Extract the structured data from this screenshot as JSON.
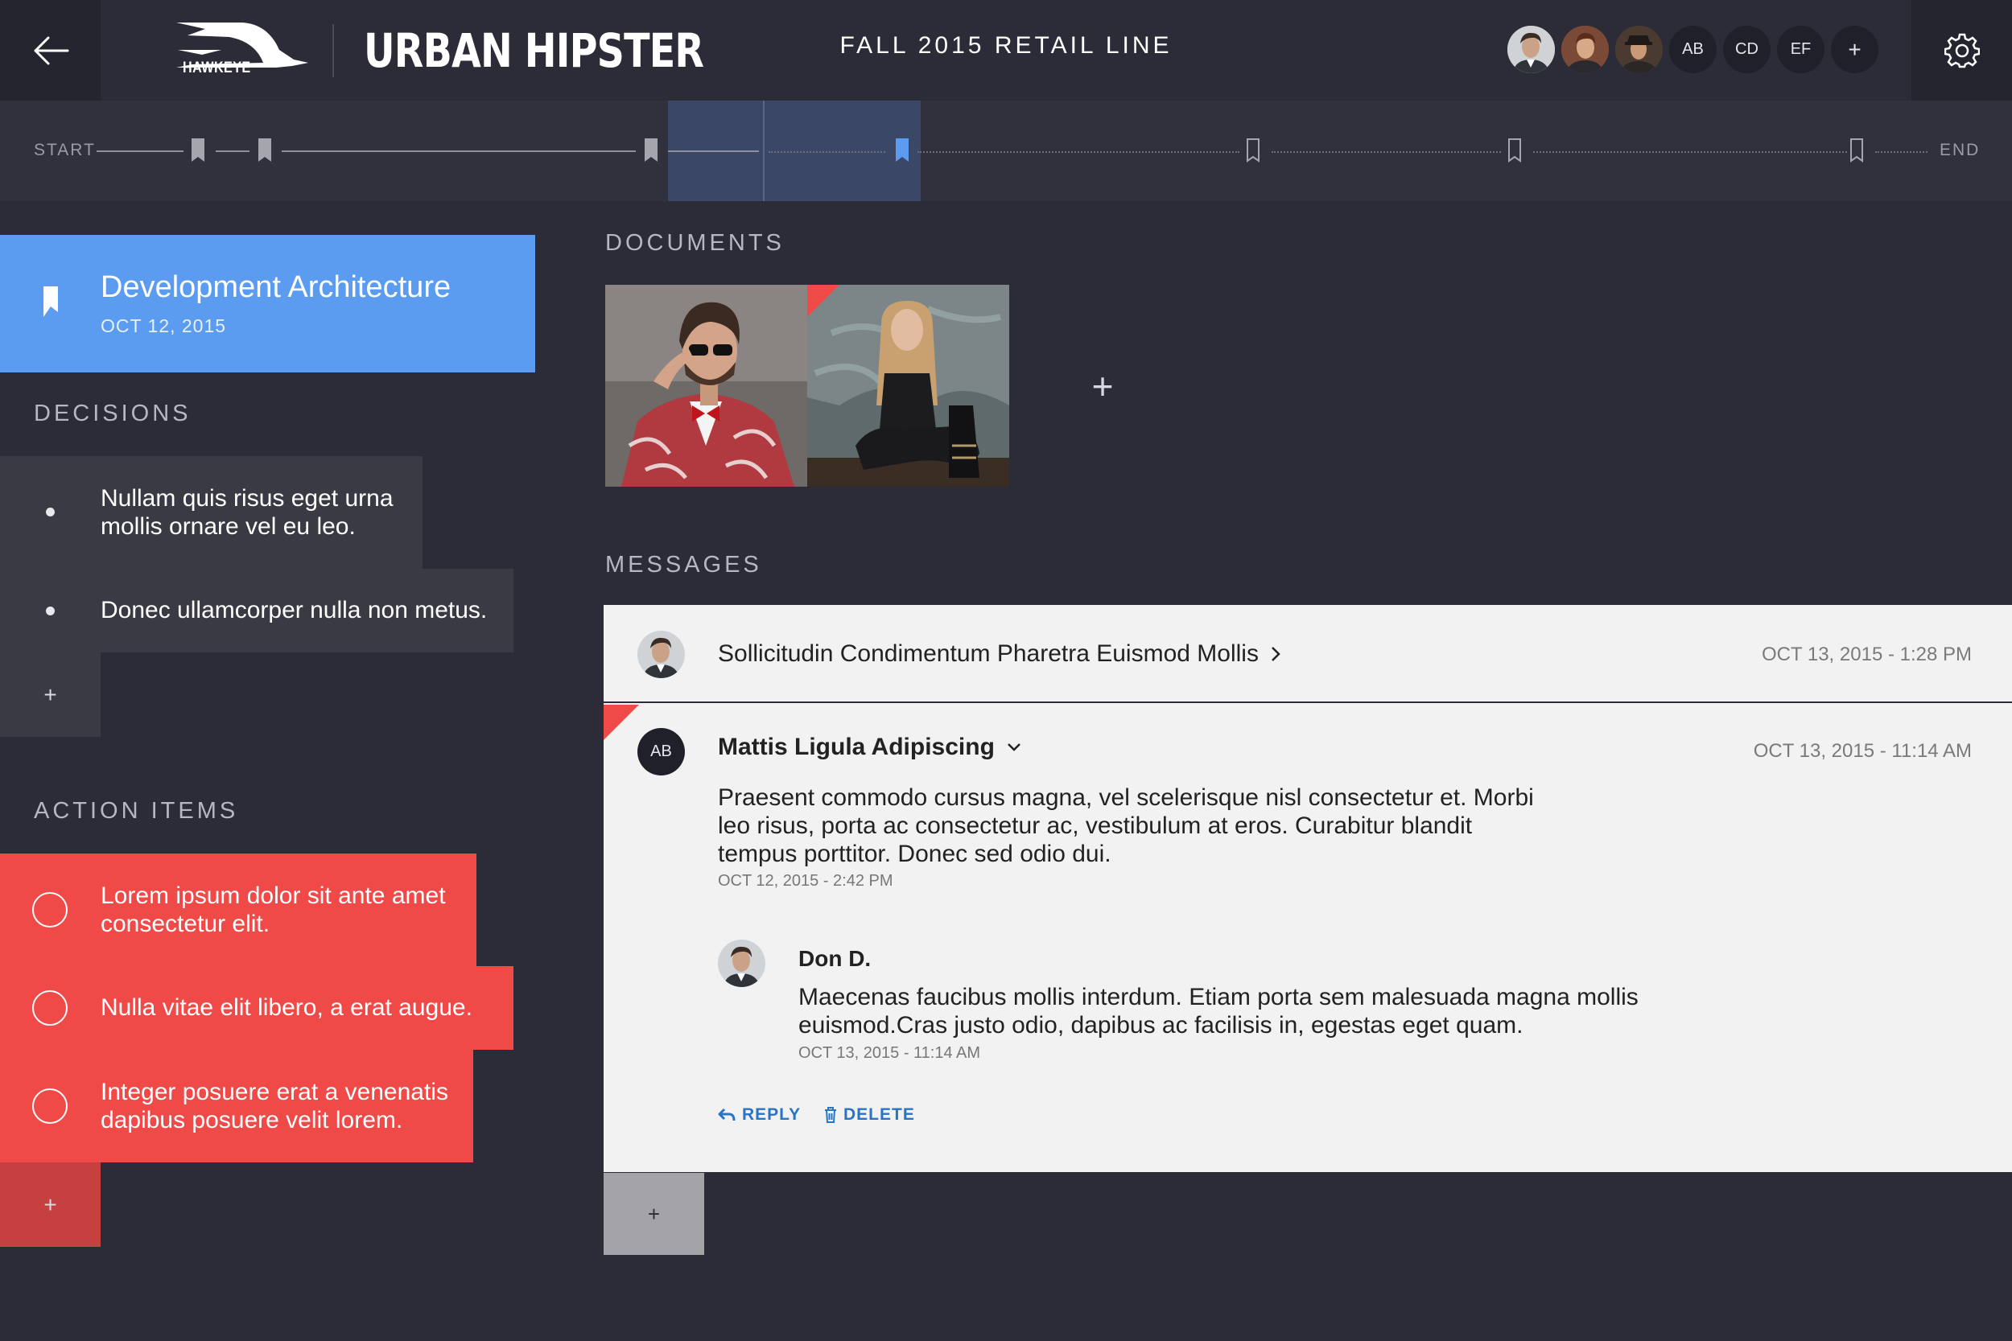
{
  "header": {
    "logo_text": "HAWKEYE",
    "brand": "URBAN HIPSTER",
    "project_title": "FALL 2015 RETAIL LINE",
    "collaborators": [
      "AB",
      "CD",
      "EF"
    ],
    "add_collaborator": "+"
  },
  "timeline": {
    "start_label": "START",
    "end_label": "END"
  },
  "milestone": {
    "title": "Development Architecture",
    "date": "OCT 12, 2015"
  },
  "decisions": {
    "heading": "DECISIONS",
    "items": [
      "Nullam quis risus eget urna mollis ornare vel eu leo.",
      "Donec ullamcorper nulla non metus."
    ],
    "add_label": "+"
  },
  "action_items": {
    "heading": "ACTION ITEMS",
    "items": [
      "Lorem ipsum dolor sit ante amet consectetur elit.",
      "Nulla vitae elit libero, a erat augue.",
      "Integer posuere erat a venenatis dapibus posuere velit lorem."
    ],
    "add_label": "+"
  },
  "documents": {
    "heading": "DOCUMENTS",
    "add_label": "+"
  },
  "messages": {
    "heading": "MESSAGES",
    "thread": {
      "title": "Sollicitudin Condimentum Pharetra Euismod Mollis",
      "time": "OCT 13, 2015 - 1:28 PM"
    },
    "message": {
      "avatar": "AB",
      "author": "Mattis Ligula Adipiscing",
      "time": "OCT 13, 2015 - 11:14 AM",
      "body": "Praesent commodo cursus magna, vel scelerisque nisl consectetur et. Morbi leo risus, porta ac consectetur ac, vestibulum at eros. Curabitur blandit tempus porttitor. Donec sed odio dui.",
      "date": "OCT 12, 2015 - 2:42 PM"
    },
    "reply": {
      "author": "Don D.",
      "body": "Maecenas faucibus mollis interdum. Etiam porta sem malesuada magna mollis euismod.Cras justo odio, dapibus ac facilisis in, egestas eget quam.",
      "date": "OCT 13, 2015 - 11:14 AM"
    },
    "reply_label": "REPLY",
    "delete_label": "DELETE",
    "add_label": "+"
  },
  "colors": {
    "background": "#2b2c38",
    "milestone_blue": "#5b9cf1",
    "action_red": "#ef4a48",
    "link_blue": "#2a74c6"
  }
}
